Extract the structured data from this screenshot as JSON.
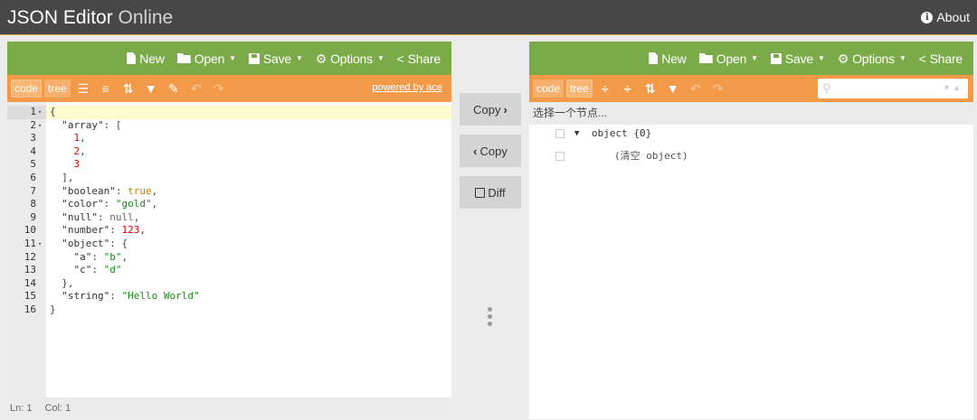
{
  "header": {
    "title_bold": "JSON Editor",
    "title_light": " Online",
    "about_label": "About"
  },
  "menu": {
    "new_label": "New",
    "open_label": "Open",
    "save_label": "Save",
    "options_label": "Options",
    "share_label": "Share"
  },
  "left_toolbar": {
    "code_mode": "code",
    "tree_mode": "tree",
    "powered_by": "powered by ace"
  },
  "code_lines": [
    {
      "n": "1",
      "fold": "▾",
      "text": "{"
    },
    {
      "n": "2",
      "fold": "▾",
      "text": "  \"array\": ["
    },
    {
      "n": "3",
      "fold": "",
      "text": "    1,"
    },
    {
      "n": "4",
      "fold": "",
      "text": "    2,"
    },
    {
      "n": "5",
      "fold": "",
      "text": "    3"
    },
    {
      "n": "6",
      "fold": "",
      "text": "  ],"
    },
    {
      "n": "7",
      "fold": "",
      "text": "  \"boolean\": true,"
    },
    {
      "n": "8",
      "fold": "",
      "text": "  \"color\": \"gold\","
    },
    {
      "n": "9",
      "fold": "",
      "text": "  \"null\": null,"
    },
    {
      "n": "10",
      "fold": "",
      "text": "  \"number\": 123,"
    },
    {
      "n": "11",
      "fold": "▾",
      "text": "  \"object\": {"
    },
    {
      "n": "12",
      "fold": "",
      "text": "    \"a\": \"b\","
    },
    {
      "n": "13",
      "fold": "",
      "text": "    \"c\": \"d\""
    },
    {
      "n": "14",
      "fold": "",
      "text": "  },"
    },
    {
      "n": "15",
      "fold": "",
      "text": "  \"string\": \"Hello World\""
    },
    {
      "n": "16",
      "fold": "",
      "text": "}"
    }
  ],
  "status": {
    "ln": "Ln: 1",
    "col": "Col: 1"
  },
  "middle": {
    "copy_right": "Copy",
    "copy_left": "Copy",
    "diff": "Diff"
  },
  "right_toolbar": {
    "code_mode": "code",
    "tree_mode": "tree",
    "search_placeholder": ""
  },
  "tree": {
    "nav_hint": "选择一个节点...",
    "root_label": "object {0}",
    "empty_label": "(清空 object)"
  },
  "colors": {
    "header_bg": "#474747",
    "menu_green": "#7bab49",
    "menu_orange": "#f29a48"
  }
}
